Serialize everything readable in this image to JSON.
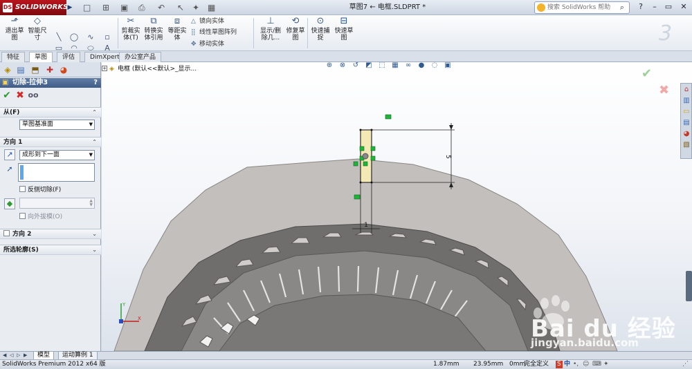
{
  "app": {
    "logo_text": "SOLIDWORKS",
    "logo_mark": "DS",
    "document_title": "草图7 ← 电框.SLDPRT *",
    "search_placeholder": "搜索 SolidWorks 帮助"
  },
  "quick_access": [
    "new-icon",
    "open-icon",
    "save-icon",
    "print-icon",
    "undo-icon",
    "select-icon",
    "rebuild-icon",
    "options-icon"
  ],
  "command_manager": {
    "exit_sketch": "退出草\n图",
    "smart_dim": "智能尺\n寸",
    "trim": "剪裁实\n体(T)",
    "convert": "转换实\n体引用",
    "offset": "等距实\n体",
    "mirror": "镜向实体",
    "linear_pattern": "线性草图阵列",
    "move": "移动实体",
    "show_delete": "显示/删\n除几...",
    "repair": "修复草\n图",
    "quick_snap": "快速捕\n捉",
    "quick_sketch": "快速草\n图"
  },
  "tabs": [
    "特征",
    "草图",
    "评估",
    "DimXpert",
    "办公室产品"
  ],
  "active_tab": 1,
  "property_manager": {
    "title": "切除-拉伸3",
    "help": "?",
    "from_label": "从(F)",
    "from_value": "草图基准面",
    "direction1_label": "方向 1",
    "direction1_value": "成形到下一面",
    "flip_side_label": "反侧切除(F)",
    "draft_label": "向外拔模(O)",
    "direction2_label": "方向 2",
    "contours_label": "所选轮廓(S)"
  },
  "tree": {
    "label": "电框 (默认<<默认>_显示..."
  },
  "dimensions": {
    "height": "5",
    "width": "1"
  },
  "watermark": {
    "brand": "Bai du 经验",
    "url": "jingyan.baidu.com"
  },
  "bottom_tabs": [
    "模型",
    "运动算例 1"
  ],
  "status": {
    "product": "SolidWorks Premium 2012 x64 版",
    "x": "1.87mm",
    "y": "23.95mm",
    "z": "0mm",
    "state": "完全定义",
    "ime_zh": "中",
    "ime_s": "S"
  },
  "colors": {
    "title_gradient_top": "#e8edf4",
    "logo_red": "#b8151d",
    "pm_header": "#4f6d97",
    "part_outer": "#c0bdbb",
    "part_inner": "#6d6b69",
    "sketch_fill": "#f3e9b4",
    "relation_green": "#1fb33a"
  }
}
